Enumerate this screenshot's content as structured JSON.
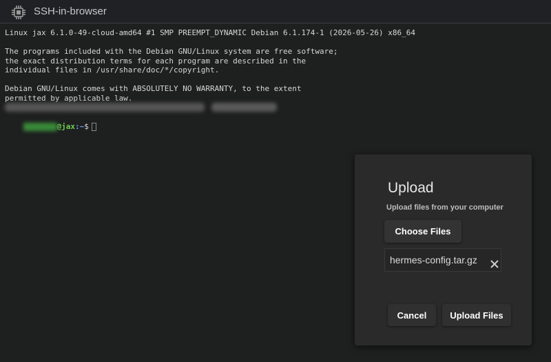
{
  "app": {
    "title": "SSH-in-browser",
    "icon": "cpu-chip-icon"
  },
  "terminal": {
    "lines": [
      "Linux jax 6.1.0-49-cloud-amd64 #1 SMP PREEMPT_DYNAMIC Debian 6.1.174-1 (2026-05-26) x86_64",
      "",
      "The programs included with the Debian GNU/Linux system are free software;",
      "the exact distribution terms for each program are described in the",
      "individual files in /usr/share/doc/*/copyright.",
      "",
      "Debian GNU/Linux comes with ABSOLUTELY NO WARRANTY, to the extent",
      "permitted by applicable law."
    ],
    "prompt": {
      "host": "@jax",
      "path": ":~",
      "sign": "$"
    },
    "colors": {
      "host": "#6fcf4f",
      "path": "#6ea6ff"
    }
  },
  "upload_dialog": {
    "title": "Upload",
    "subtitle": "Upload files from your computer",
    "choose_label": "Choose Files",
    "file_name": "hermes-config.tar.gz",
    "remove_icon": "close-icon",
    "cancel_label": "Cancel",
    "upload_label": "Upload Files"
  }
}
